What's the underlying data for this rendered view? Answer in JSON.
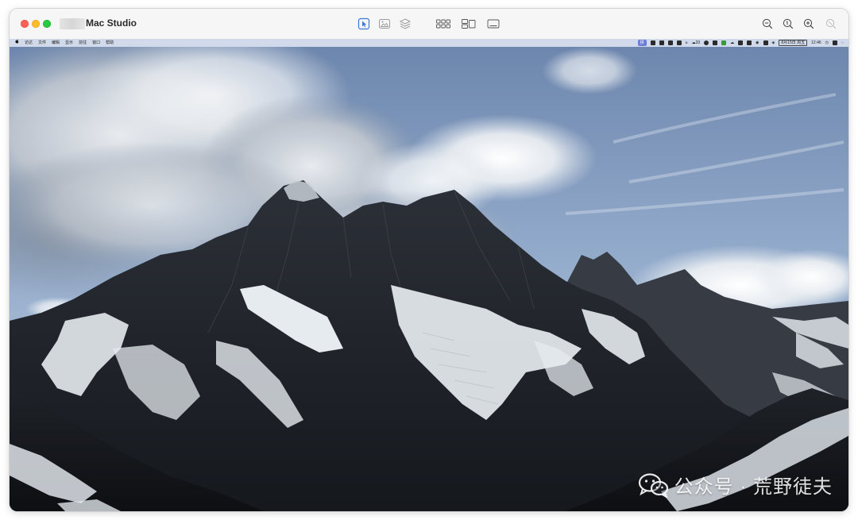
{
  "window": {
    "title": "Mac Studio"
  },
  "menubar": {
    "left_items": [
      "访达",
      "文件",
      "编辑",
      "显示",
      "前往",
      "窗口",
      "帮助"
    ],
    "right_items": {
      "battery_value": "33",
      "date": "8月15日 周五",
      "time": "12:46"
    }
  },
  "watermark": {
    "text": "公众号 · 荒野徒夫"
  },
  "colors": {
    "accent": "#3a7bd5",
    "red": "#fe5f57",
    "yellow": "#febc2e",
    "green": "#28c840"
  }
}
